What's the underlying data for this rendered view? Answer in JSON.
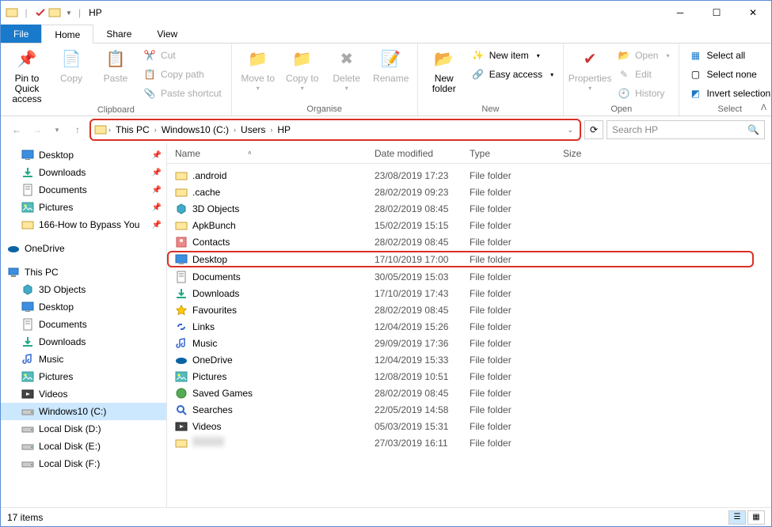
{
  "window": {
    "title": "HP"
  },
  "menubar": {
    "file": "File",
    "tabs": [
      "Home",
      "Share",
      "View"
    ],
    "active": 0
  },
  "ribbon": {
    "groups": {
      "clipboard": {
        "label": "Clipboard",
        "pin": "Pin to Quick access",
        "copy": "Copy",
        "paste": "Paste",
        "cut": "Cut",
        "copypath": "Copy path",
        "pasteshortcut": "Paste shortcut"
      },
      "organise": {
        "label": "Organise",
        "moveto": "Move to",
        "copyto": "Copy to",
        "delete": "Delete",
        "rename": "Rename"
      },
      "new": {
        "label": "New",
        "newfolder": "New folder",
        "newitem": "New item",
        "easyaccess": "Easy access"
      },
      "open": {
        "label": "Open",
        "properties": "Properties",
        "open": "Open",
        "edit": "Edit",
        "history": "History"
      },
      "select": {
        "label": "Select",
        "selectall": "Select all",
        "selectnone": "Select none",
        "invert": "Invert selection"
      }
    }
  },
  "breadcrumb": [
    "This PC",
    "Windows10 (C:)",
    "Users",
    "HP"
  ],
  "search": {
    "placeholder": "Search HP"
  },
  "columns": {
    "name": "Name",
    "date": "Date modified",
    "type": "Type",
    "size": "Size"
  },
  "nav": {
    "quick": [
      {
        "label": "Desktop",
        "pin": true,
        "icon": "desktop"
      },
      {
        "label": "Downloads",
        "pin": true,
        "icon": "downloads"
      },
      {
        "label": "Documents",
        "pin": true,
        "icon": "documents"
      },
      {
        "label": "Pictures",
        "pin": true,
        "icon": "pictures"
      },
      {
        "label": "166-How to Bypass You",
        "pin": true,
        "icon": "folder"
      }
    ],
    "onedrive": "OneDrive",
    "thispc": "This PC",
    "pcitems": [
      {
        "label": "3D Objects",
        "icon": "3d"
      },
      {
        "label": "Desktop",
        "icon": "desktop"
      },
      {
        "label": "Documents",
        "icon": "documents"
      },
      {
        "label": "Downloads",
        "icon": "downloads"
      },
      {
        "label": "Music",
        "icon": "music"
      },
      {
        "label": "Pictures",
        "icon": "pictures"
      },
      {
        "label": "Videos",
        "icon": "videos"
      },
      {
        "label": "Windows10 (C:)",
        "icon": "drive",
        "selected": true
      },
      {
        "label": "Local Disk (D:)",
        "icon": "drive"
      },
      {
        "label": "Local Disk (E:)",
        "icon": "drive"
      },
      {
        "label": "Local Disk (F:)",
        "icon": "drive"
      }
    ]
  },
  "files": [
    {
      "name": ".android",
      "date": "23/08/2019 17:23",
      "type": "File folder",
      "icon": "folder"
    },
    {
      "name": ".cache",
      "date": "28/02/2019 09:23",
      "type": "File folder",
      "icon": "folder"
    },
    {
      "name": "3D Objects",
      "date": "28/02/2019 08:45",
      "type": "File folder",
      "icon": "3d"
    },
    {
      "name": "ApkBunch",
      "date": "15/02/2019 15:15",
      "type": "File folder",
      "icon": "folder"
    },
    {
      "name": "Contacts",
      "date": "28/02/2019 08:45",
      "type": "File folder",
      "icon": "contacts"
    },
    {
      "name": "Desktop",
      "date": "17/10/2019 17:00",
      "type": "File folder",
      "icon": "desktop",
      "highlight": true
    },
    {
      "name": "Documents",
      "date": "30/05/2019 15:03",
      "type": "File folder",
      "icon": "documents"
    },
    {
      "name": "Downloads",
      "date": "17/10/2019 17:43",
      "type": "File folder",
      "icon": "downloads"
    },
    {
      "name": "Favourites",
      "date": "28/02/2019 08:45",
      "type": "File folder",
      "icon": "favorites"
    },
    {
      "name": "Links",
      "date": "12/04/2019 15:26",
      "type": "File folder",
      "icon": "links"
    },
    {
      "name": "Music",
      "date": "29/09/2019 17:36",
      "type": "File folder",
      "icon": "music"
    },
    {
      "name": "OneDrive",
      "date": "12/04/2019 15:33",
      "type": "File folder",
      "icon": "onedrive"
    },
    {
      "name": "Pictures",
      "date": "12/08/2019 10:51",
      "type": "File folder",
      "icon": "pictures"
    },
    {
      "name": "Saved Games",
      "date": "28/02/2019 08:45",
      "type": "File folder",
      "icon": "games"
    },
    {
      "name": "Searches",
      "date": "22/05/2019 14:58",
      "type": "File folder",
      "icon": "searches"
    },
    {
      "name": "Videos",
      "date": "05/03/2019 15:31",
      "type": "File folder",
      "icon": "videos"
    },
    {
      "name": "",
      "date": "27/03/2019 16:11",
      "type": "File folder",
      "icon": "folder",
      "blurred": true
    }
  ],
  "status": {
    "count": "17 items"
  }
}
